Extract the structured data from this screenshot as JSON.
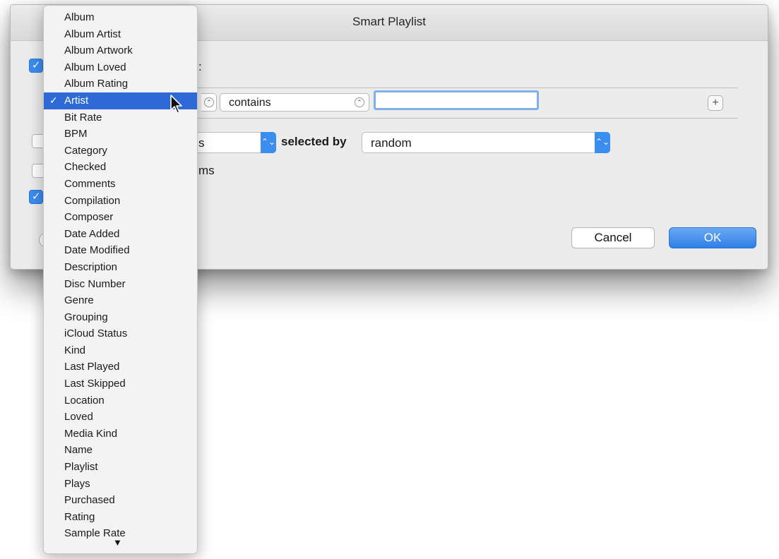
{
  "dialog": {
    "title": "Smart Playlist",
    "match_label_fragment": ":",
    "condition": {
      "operator": "contains",
      "value": ""
    },
    "limit": {
      "unit_fragment": "s",
      "selected_by_label": "selected by",
      "selected_by_value": "random"
    },
    "match_checked_items_fragment": "ms",
    "checkboxes": {
      "match_rules": true,
      "limit_to": false,
      "match_only_checked": false,
      "live_updating": true
    },
    "cancel_label": "Cancel",
    "ok_label": "OK",
    "help_label": "?"
  },
  "menu": {
    "items": [
      {
        "label": "Album",
        "selected": false
      },
      {
        "label": "Album Artist",
        "selected": false
      },
      {
        "label": "Album Artwork",
        "selected": false
      },
      {
        "label": "Album Loved",
        "selected": false
      },
      {
        "label": "Album Rating",
        "selected": false
      },
      {
        "label": "Artist",
        "selected": true
      },
      {
        "label": "Bit Rate",
        "selected": false
      },
      {
        "label": "BPM",
        "selected": false
      },
      {
        "label": "Category",
        "selected": false
      },
      {
        "label": "Checked",
        "selected": false
      },
      {
        "label": "Comments",
        "selected": false
      },
      {
        "label": "Compilation",
        "selected": false
      },
      {
        "label": "Composer",
        "selected": false
      },
      {
        "label": "Date Added",
        "selected": false
      },
      {
        "label": "Date Modified",
        "selected": false
      },
      {
        "label": "Description",
        "selected": false
      },
      {
        "label": "Disc Number",
        "selected": false
      },
      {
        "label": "Genre",
        "selected": false
      },
      {
        "label": "Grouping",
        "selected": false
      },
      {
        "label": "iCloud Status",
        "selected": false
      },
      {
        "label": "Kind",
        "selected": false
      },
      {
        "label": "Last Played",
        "selected": false
      },
      {
        "label": "Last Skipped",
        "selected": false
      },
      {
        "label": "Location",
        "selected": false
      },
      {
        "label": "Loved",
        "selected": false
      },
      {
        "label": "Media Kind",
        "selected": false
      },
      {
        "label": "Name",
        "selected": false
      },
      {
        "label": "Playlist",
        "selected": false
      },
      {
        "label": "Plays",
        "selected": false
      },
      {
        "label": "Purchased",
        "selected": false
      },
      {
        "label": "Rating",
        "selected": false
      },
      {
        "label": "Sample Rate",
        "selected": false
      }
    ],
    "check_glyph": "✓",
    "scroll_more_glyph": "▼"
  },
  "colors": {
    "accent": "#2e6ad6",
    "button_blue": "#3b8df0"
  },
  "icons": {
    "cursor": "arrow-pointer-icon",
    "add": "plus-icon",
    "help": "question-mark-icon"
  }
}
